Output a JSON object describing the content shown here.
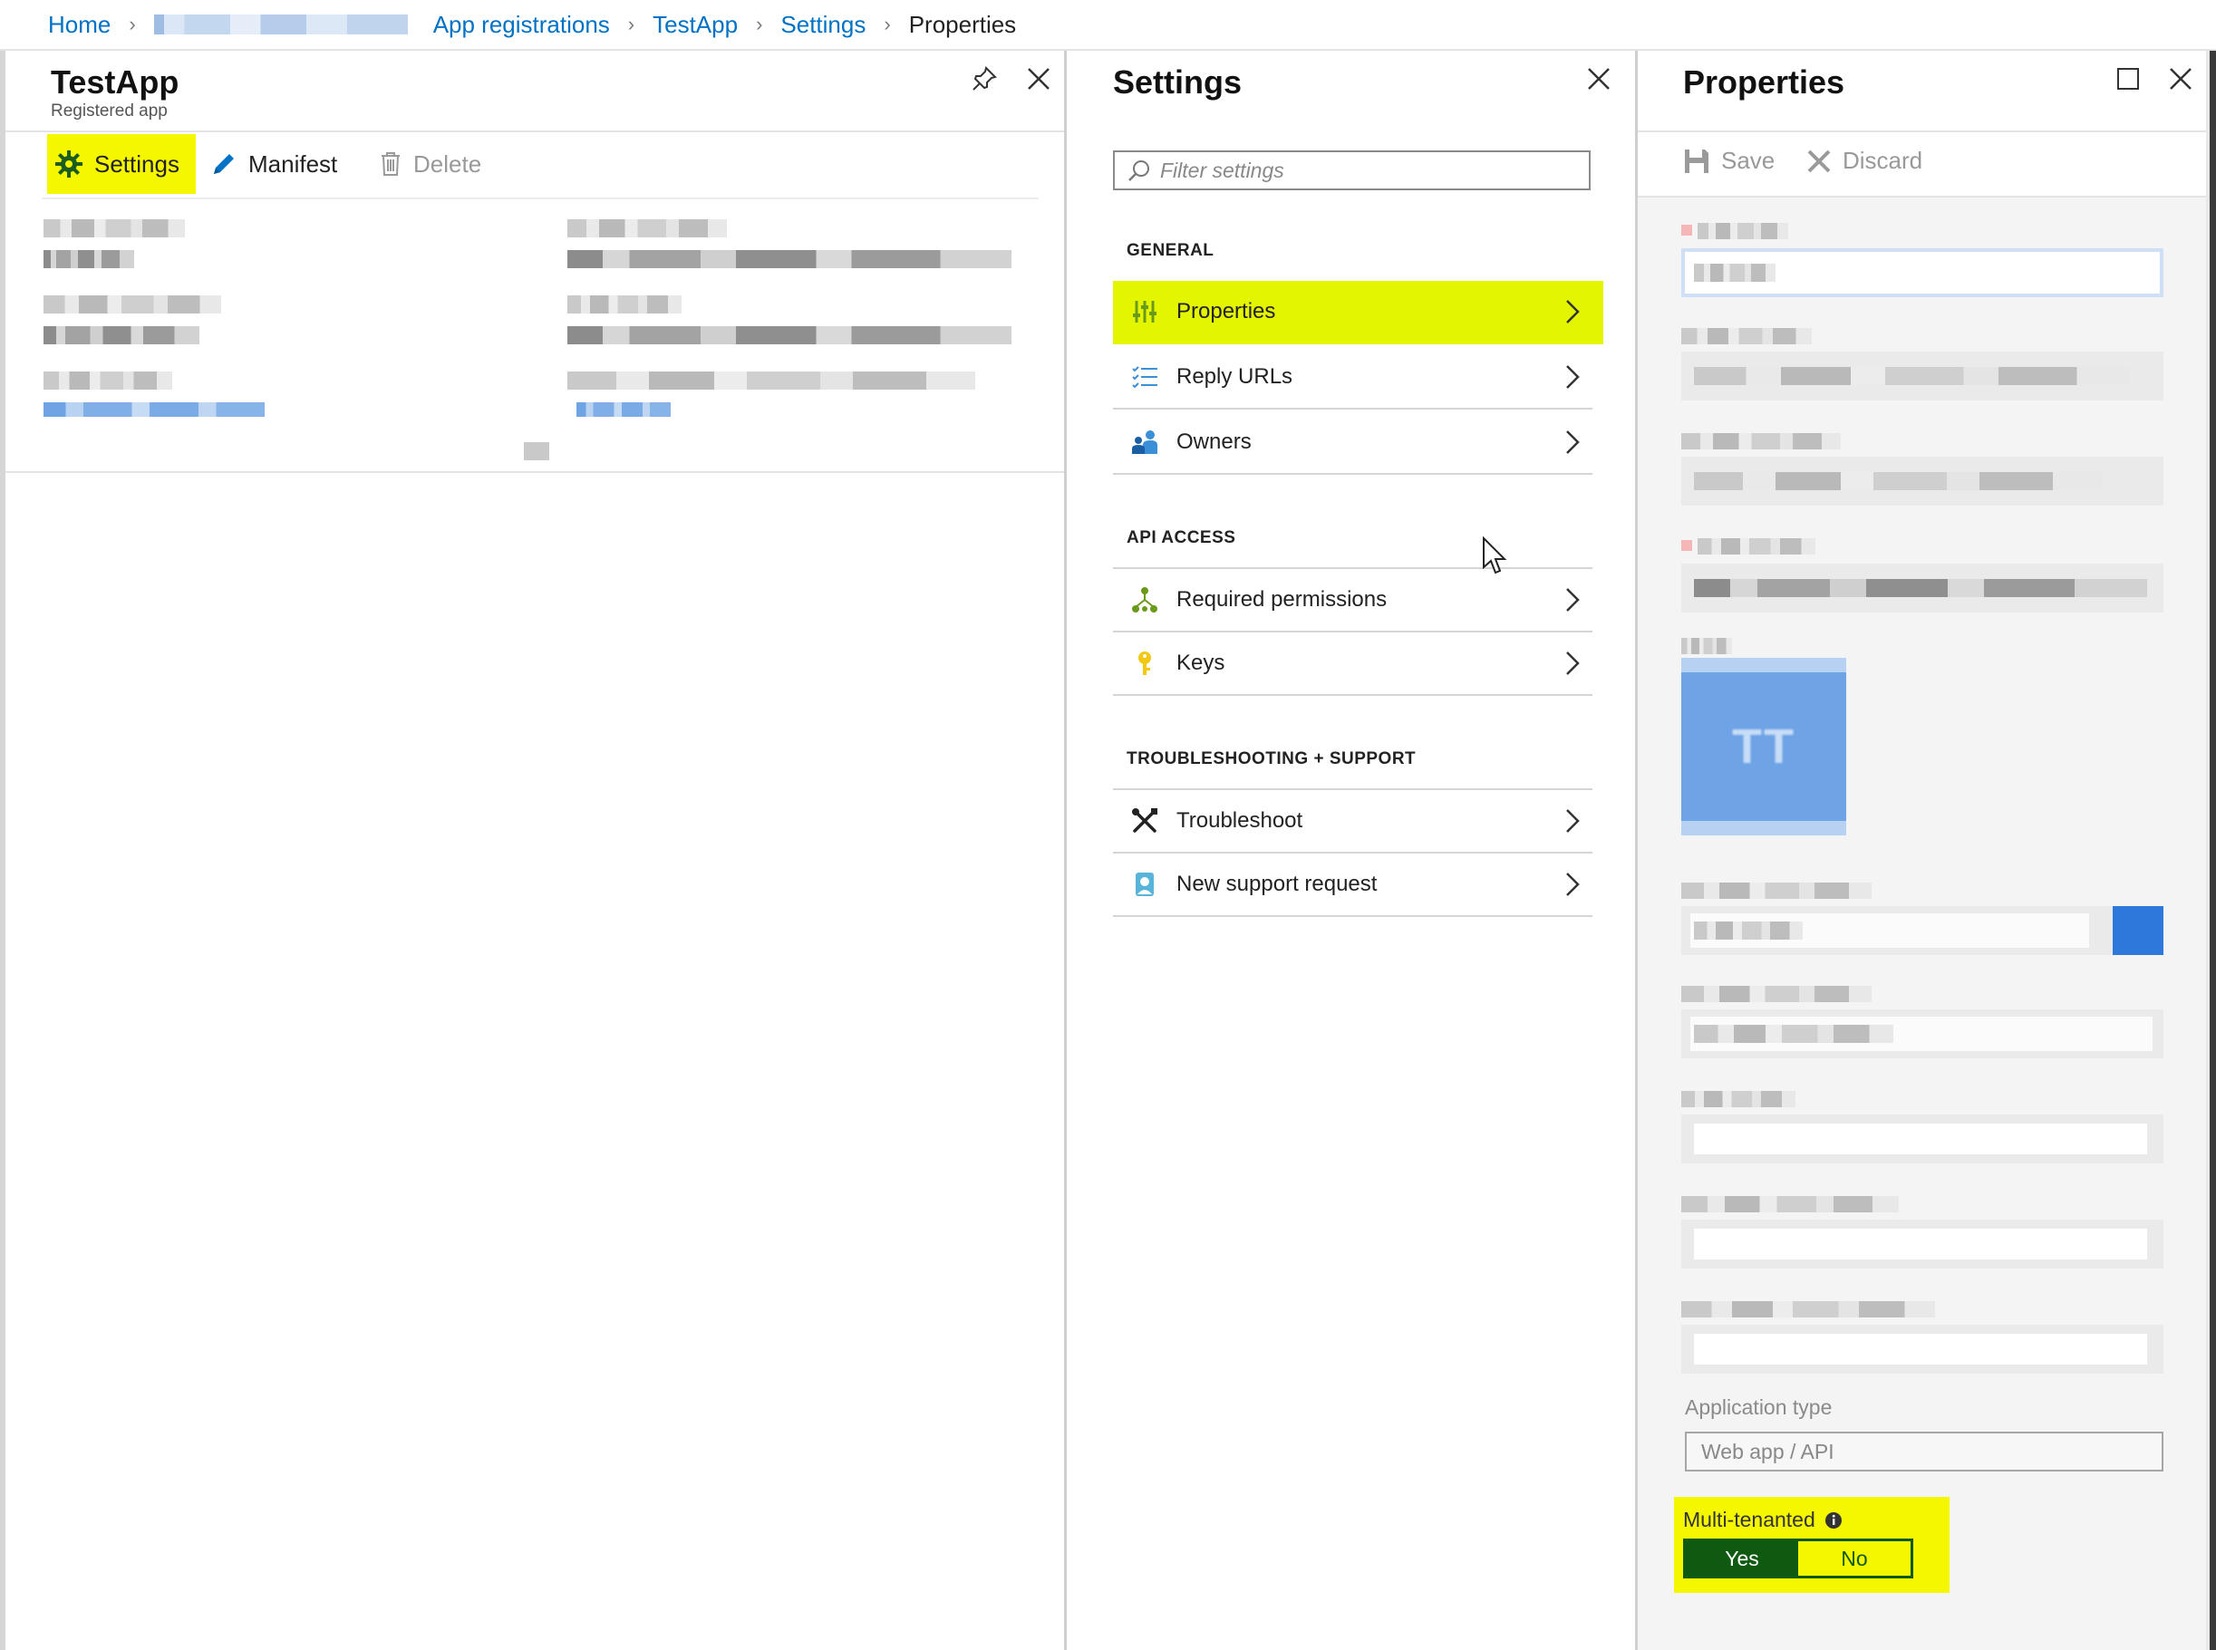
{
  "breadcrumb": {
    "items": [
      "Home",
      "App registrations",
      "TestApp",
      "Settings"
    ],
    "current": "Properties"
  },
  "pane_app": {
    "title": "TestApp",
    "subtitle": "Registered app",
    "commands": {
      "settings": "Settings",
      "manifest": "Manifest",
      "delete": "Delete"
    }
  },
  "pane_settings": {
    "title": "Settings",
    "filter_placeholder": "Filter settings",
    "groups": {
      "general": "GENERAL",
      "api_access": "API ACCESS",
      "troubleshooting": "TROUBLESHOOTING + SUPPORT"
    },
    "items": {
      "properties": "Properties",
      "reply_urls": "Reply URLs",
      "owners": "Owners",
      "required_permissions": "Required permissions",
      "keys": "Keys",
      "troubleshoot": "Troubleshoot",
      "new_support_request": "New support request"
    }
  },
  "pane_properties": {
    "title": "Properties",
    "commands": {
      "save": "Save",
      "discard": "Discard"
    },
    "application_type": {
      "label": "Application type",
      "value": "Web app / API"
    },
    "multi_tenanted": {
      "label": "Multi-tenanted",
      "yes": "Yes",
      "no": "No",
      "selected": "Yes"
    }
  },
  "colors": {
    "link": "#0072c6",
    "highlight": "#f4f700",
    "toggle_on": "#0e5a10"
  }
}
